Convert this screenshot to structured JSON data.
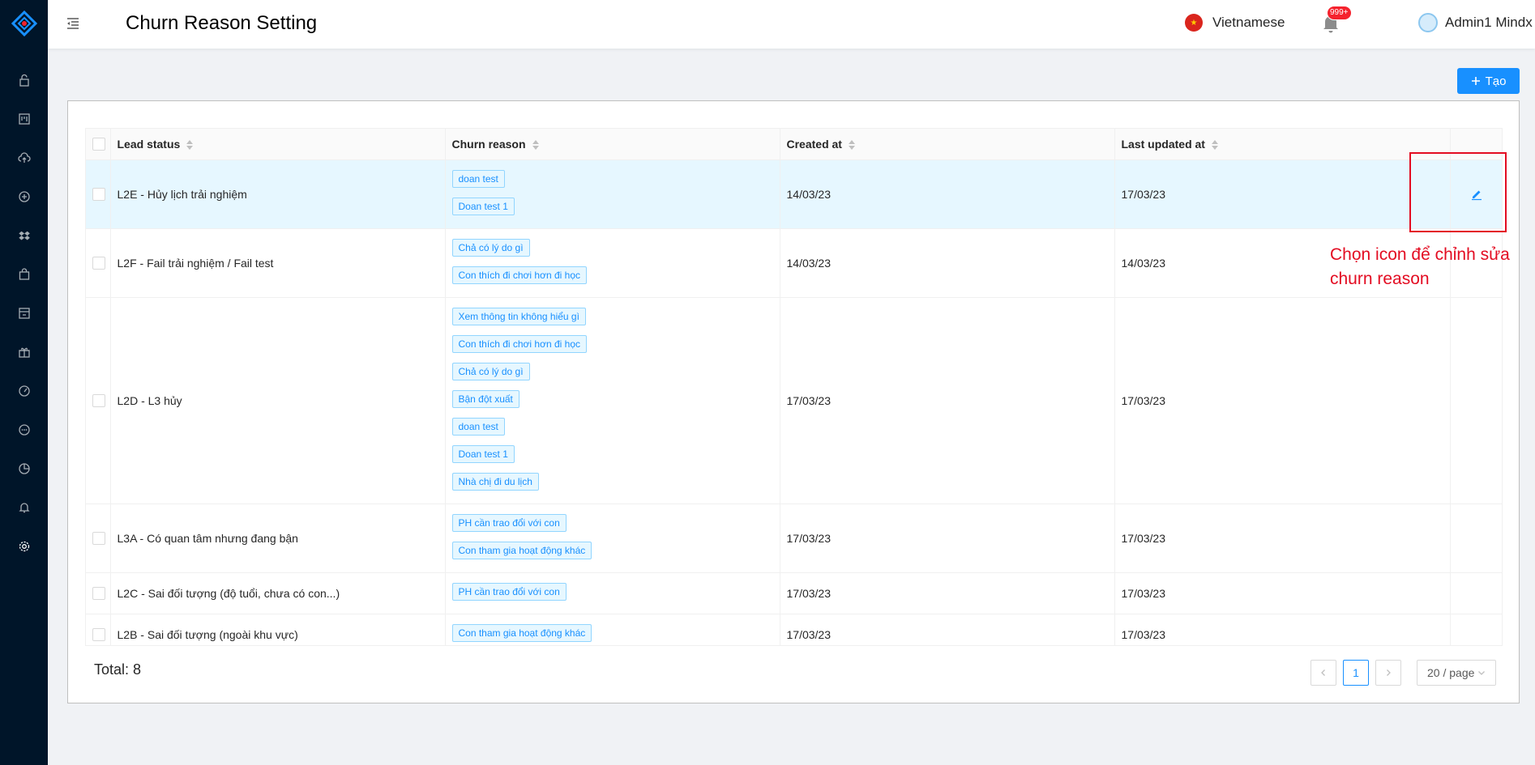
{
  "header": {
    "title": "Churn Reason Setting",
    "language": "Vietnamese",
    "notifications_badge": "999+",
    "user_name": "Admin1 Mindx"
  },
  "sidebar": {
    "items": [
      {
        "icon": "unlock-icon"
      },
      {
        "icon": "board-icon"
      },
      {
        "icon": "cloud-upload-icon"
      },
      {
        "icon": "plus-circle-icon"
      },
      {
        "icon": "dropbox-icon"
      },
      {
        "icon": "shopping-bag-icon"
      },
      {
        "icon": "shop-icon"
      },
      {
        "icon": "gift-icon"
      },
      {
        "icon": "dashboard-icon"
      },
      {
        "icon": "message-icon"
      },
      {
        "icon": "pie-chart-icon"
      },
      {
        "icon": "bell-icon"
      },
      {
        "icon": "setting-icon"
      }
    ]
  },
  "toolbar": {
    "create_label": "Tạo"
  },
  "table": {
    "columns": [
      "Lead status",
      "Churn reason",
      "Created at",
      "Last updated at"
    ],
    "rows": [
      {
        "lead_status": "L2E - Hủy lịch trải nghiệm",
        "reasons": [
          "doan test",
          "Doan test 1"
        ],
        "created_at": "14/03/23",
        "updated_at": "17/03/23"
      },
      {
        "lead_status": "L2F - Fail trải nghiệm / Fail test",
        "reasons": [
          "Chả có lý do gì",
          "Con thích đi chơi hơn đi học"
        ],
        "created_at": "14/03/23",
        "updated_at": "14/03/23"
      },
      {
        "lead_status": "L2D - L3 hủy",
        "reasons": [
          "Xem thông tin không hiểu gì",
          "Con thích đi chơi hơn đi học",
          "Chả có lý do gì",
          "Bận đột xuất",
          "doan test",
          "Doan test 1",
          "Nhà chị đi du lịch"
        ],
        "created_at": "17/03/23",
        "updated_at": "17/03/23"
      },
      {
        "lead_status": "L3A - Có quan tâm nhưng đang bận",
        "reasons": [
          "PH cần trao đổi với con",
          "Con tham gia hoạt động khác"
        ],
        "created_at": "17/03/23",
        "updated_at": "17/03/23"
      },
      {
        "lead_status": "L2C - Sai đối tượng (độ tuổi, chưa có con...)",
        "reasons": [
          "PH cần trao đổi với con"
        ],
        "created_at": "17/03/23",
        "updated_at": "17/03/23"
      },
      {
        "lead_status": "L2B - Sai đối tượng (ngoài khu vực)",
        "reasons": [
          "Con tham gia hoạt động khác"
        ],
        "created_at": "17/03/23",
        "updated_at": "17/03/23"
      }
    ]
  },
  "footer": {
    "total_label": "Total: 8",
    "current_page": "1",
    "page_size": "20 / page"
  },
  "annotation": {
    "text": "Chọn icon để chỉnh sửa churn reason"
  },
  "colors": {
    "sidebar_bg": "#001529",
    "primary": "#1890ff",
    "annotation_red": "#e30c22"
  }
}
